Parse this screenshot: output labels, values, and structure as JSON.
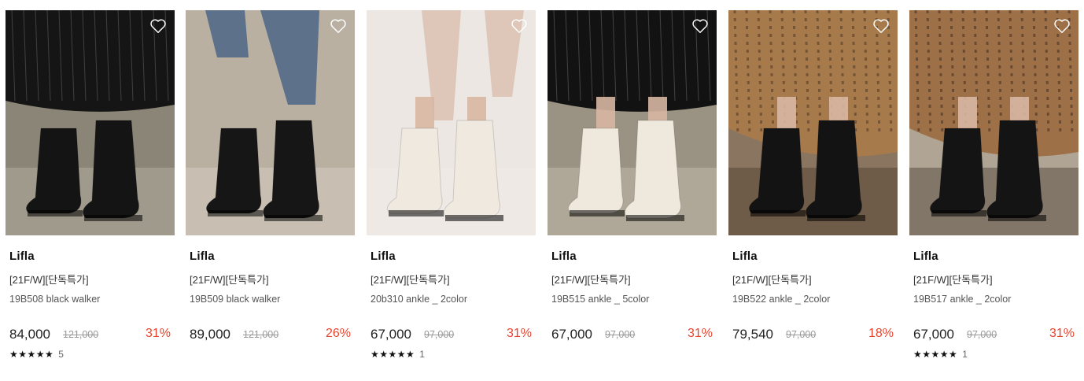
{
  "products": [
    {
      "brand": "Lifla",
      "tag": "[21F/W][단독특가]",
      "name": "19B508 black walker",
      "price": "84,000",
      "original_price": "121,000",
      "discount": "31%",
      "stars": "★★★★★",
      "rating_value": 4.8,
      "review_count": "5",
      "photo_scene": "pleated black skirt, black lace-up combat boots, grey socks",
      "colors": {
        "bg": "#8a8576",
        "top": "#151515",
        "accent": "#c9c2b6",
        "boot": "#141414"
      }
    },
    {
      "brand": "Lifla",
      "tag": "[21F/W][단독특가]",
      "name": "19B509 black walker",
      "price": "89,000",
      "original_price": "121,000",
      "discount": "26%",
      "stars": "",
      "review_count": "",
      "photo_scene": "blue jeans, black lace-up boots with chain, wooden dresser",
      "colors": {
        "bg": "#b9b0a2",
        "top": "#5d728a",
        "accent": "#e6ddd0",
        "boot": "#161616"
      }
    },
    {
      "brand": "Lifla",
      "tag": "[21F/W][단독특가]",
      "name": "20b310 ankle _ 2color",
      "price": "67,000",
      "original_price": "97,000",
      "discount": "31%",
      "stars": "★★★★★",
      "rating_value": 5,
      "review_count": "1",
      "photo_scene": "bare legs, ivory block-heel ankle boots, light background",
      "colors": {
        "bg": "#ece7e2",
        "top": "#d9b8a8",
        "accent": "#f3efe9",
        "boot": "#efe9e0"
      }
    },
    {
      "brand": "Lifla",
      "tag": "[21F/W][단독특가]",
      "name": "19B515 ankle _ 5color",
      "price": "67,000",
      "original_price": "97,000",
      "discount": "31%",
      "stars": "",
      "review_count": "",
      "photo_scene": "black pleated skirt, ivory pointed ankle boots, ornate bench",
      "colors": {
        "bg": "#9a9282",
        "top": "#121212",
        "accent": "#d8d0c2",
        "boot": "#efe8dd"
      }
    },
    {
      "brand": "Lifla",
      "tag": "[21F/W][단독특가]",
      "name": "19B522 ankle _ 2color",
      "price": "79,540",
      "original_price": "97,000",
      "discount": "18%",
      "stars": "",
      "review_count": "",
      "photo_scene": "leopard print skirt, black suede sock ankle boots, armchair",
      "colors": {
        "bg": "#8a7660",
        "top": "#a77a4c",
        "accent": "#3a2a1c",
        "boot": "#131313"
      }
    },
    {
      "brand": "Lifla",
      "tag": "[21F/W][단독특가]",
      "name": "19B517 ankle _ 2color",
      "price": "67,000",
      "original_price": "97,000",
      "discount": "31%",
      "stars": "★★★★★",
      "rating_value": 5,
      "review_count": "1",
      "photo_scene": "leopard print skirt, black suede ankle boots with strap",
      "colors": {
        "bg": "#b0a594",
        "top": "#9e7048",
        "accent": "#2c2016",
        "boot": "#141414"
      }
    }
  ],
  "icons": {
    "wishlist": "heart-outline-icon",
    "rating": "star-icon"
  },
  "theme": {
    "discount_color": "#e8452e",
    "strike_color": "#999999"
  }
}
